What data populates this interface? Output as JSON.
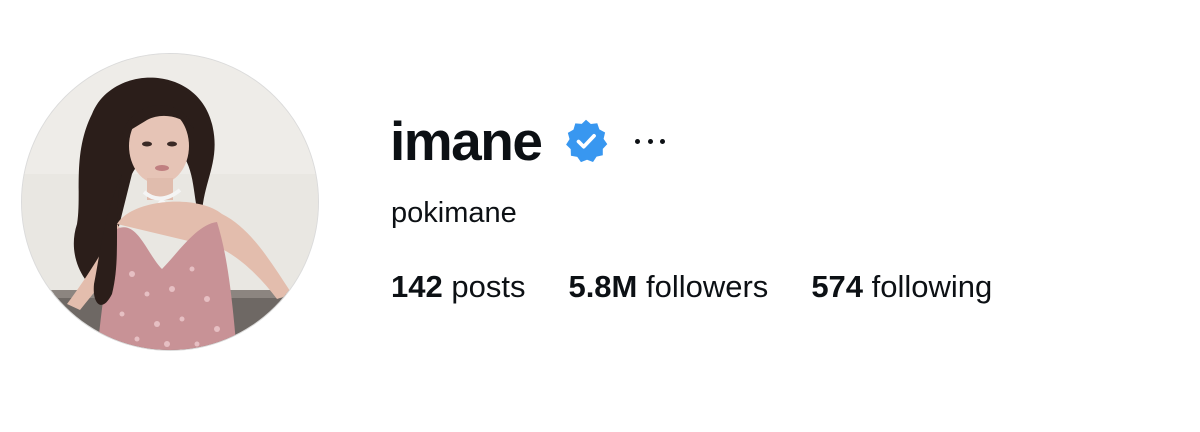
{
  "profile": {
    "username": "imane",
    "display_name": "pokimane",
    "verified": true,
    "verified_color": "#3897f0",
    "avatar_icon": "profile-photo",
    "more_icon": "ellipsis-icon"
  },
  "stats": {
    "posts": {
      "count": "142",
      "label": "posts"
    },
    "followers": {
      "count": "5.8M",
      "label": "followers"
    },
    "following": {
      "count": "574",
      "label": "following"
    }
  }
}
